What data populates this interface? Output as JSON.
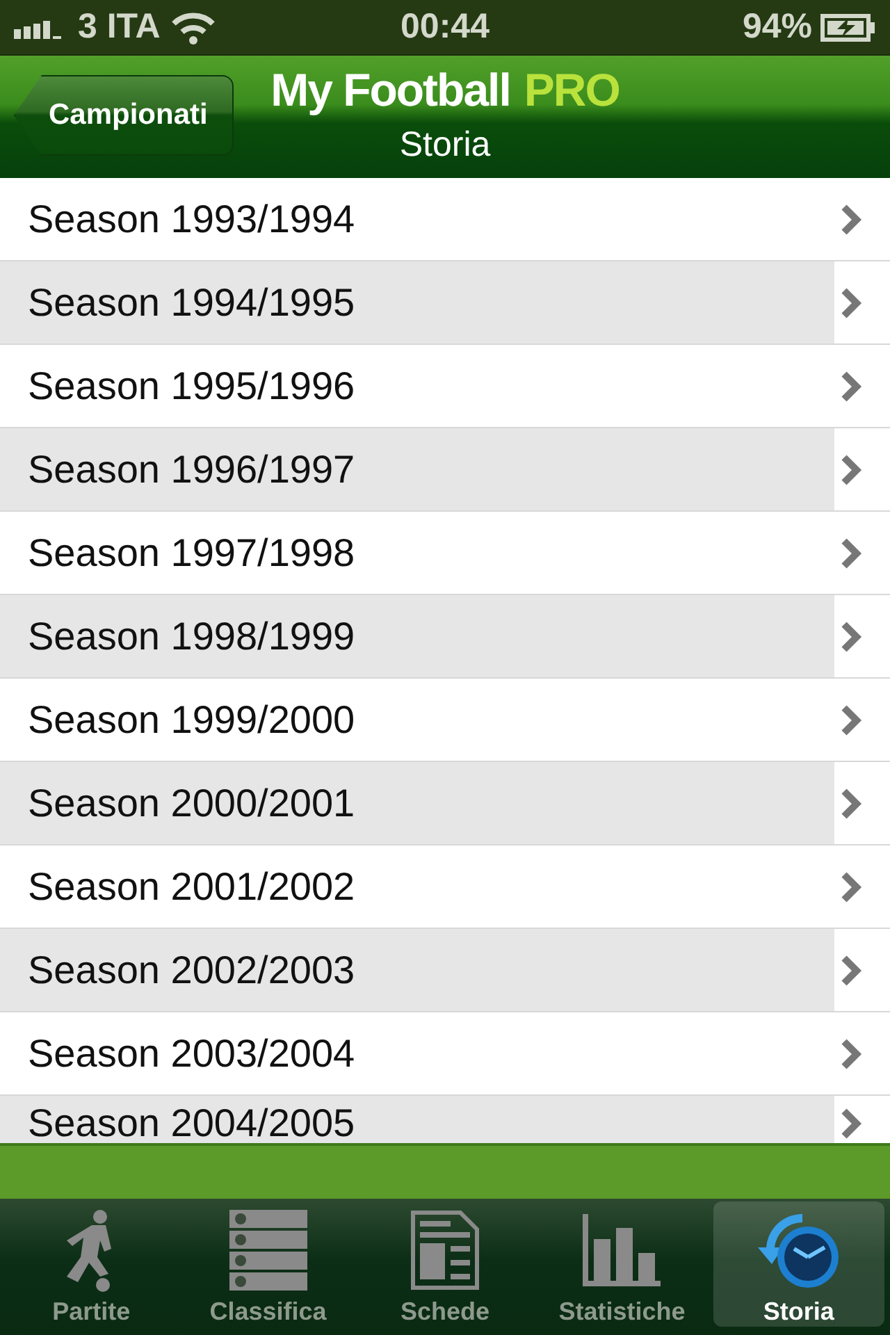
{
  "status_bar": {
    "carrier": "3 ITA",
    "time": "00:44",
    "battery": "94%"
  },
  "nav_bar": {
    "back_button": "Campionati",
    "title": "My Football",
    "title_accent": "PRO",
    "subtitle": "Storia"
  },
  "seasons": [
    {
      "label": "Season 1993/1994"
    },
    {
      "label": "Season 1994/1995"
    },
    {
      "label": "Season 1995/1996"
    },
    {
      "label": "Season 1996/1997"
    },
    {
      "label": "Season 1997/1998"
    },
    {
      "label": "Season 1998/1999"
    },
    {
      "label": "Season 1999/2000"
    },
    {
      "label": "Season 2000/2001"
    },
    {
      "label": "Season 2001/2002"
    },
    {
      "label": "Season 2002/2003"
    },
    {
      "label": "Season 2003/2004"
    },
    {
      "label": "Season 2004/2005"
    }
  ],
  "tab_bar": [
    {
      "label": "Partite",
      "selected": false
    },
    {
      "label": "Classifica",
      "selected": false
    },
    {
      "label": "Schede",
      "selected": false
    },
    {
      "label": "Statistiche",
      "selected": false
    },
    {
      "label": "Storia",
      "selected": true
    }
  ]
}
